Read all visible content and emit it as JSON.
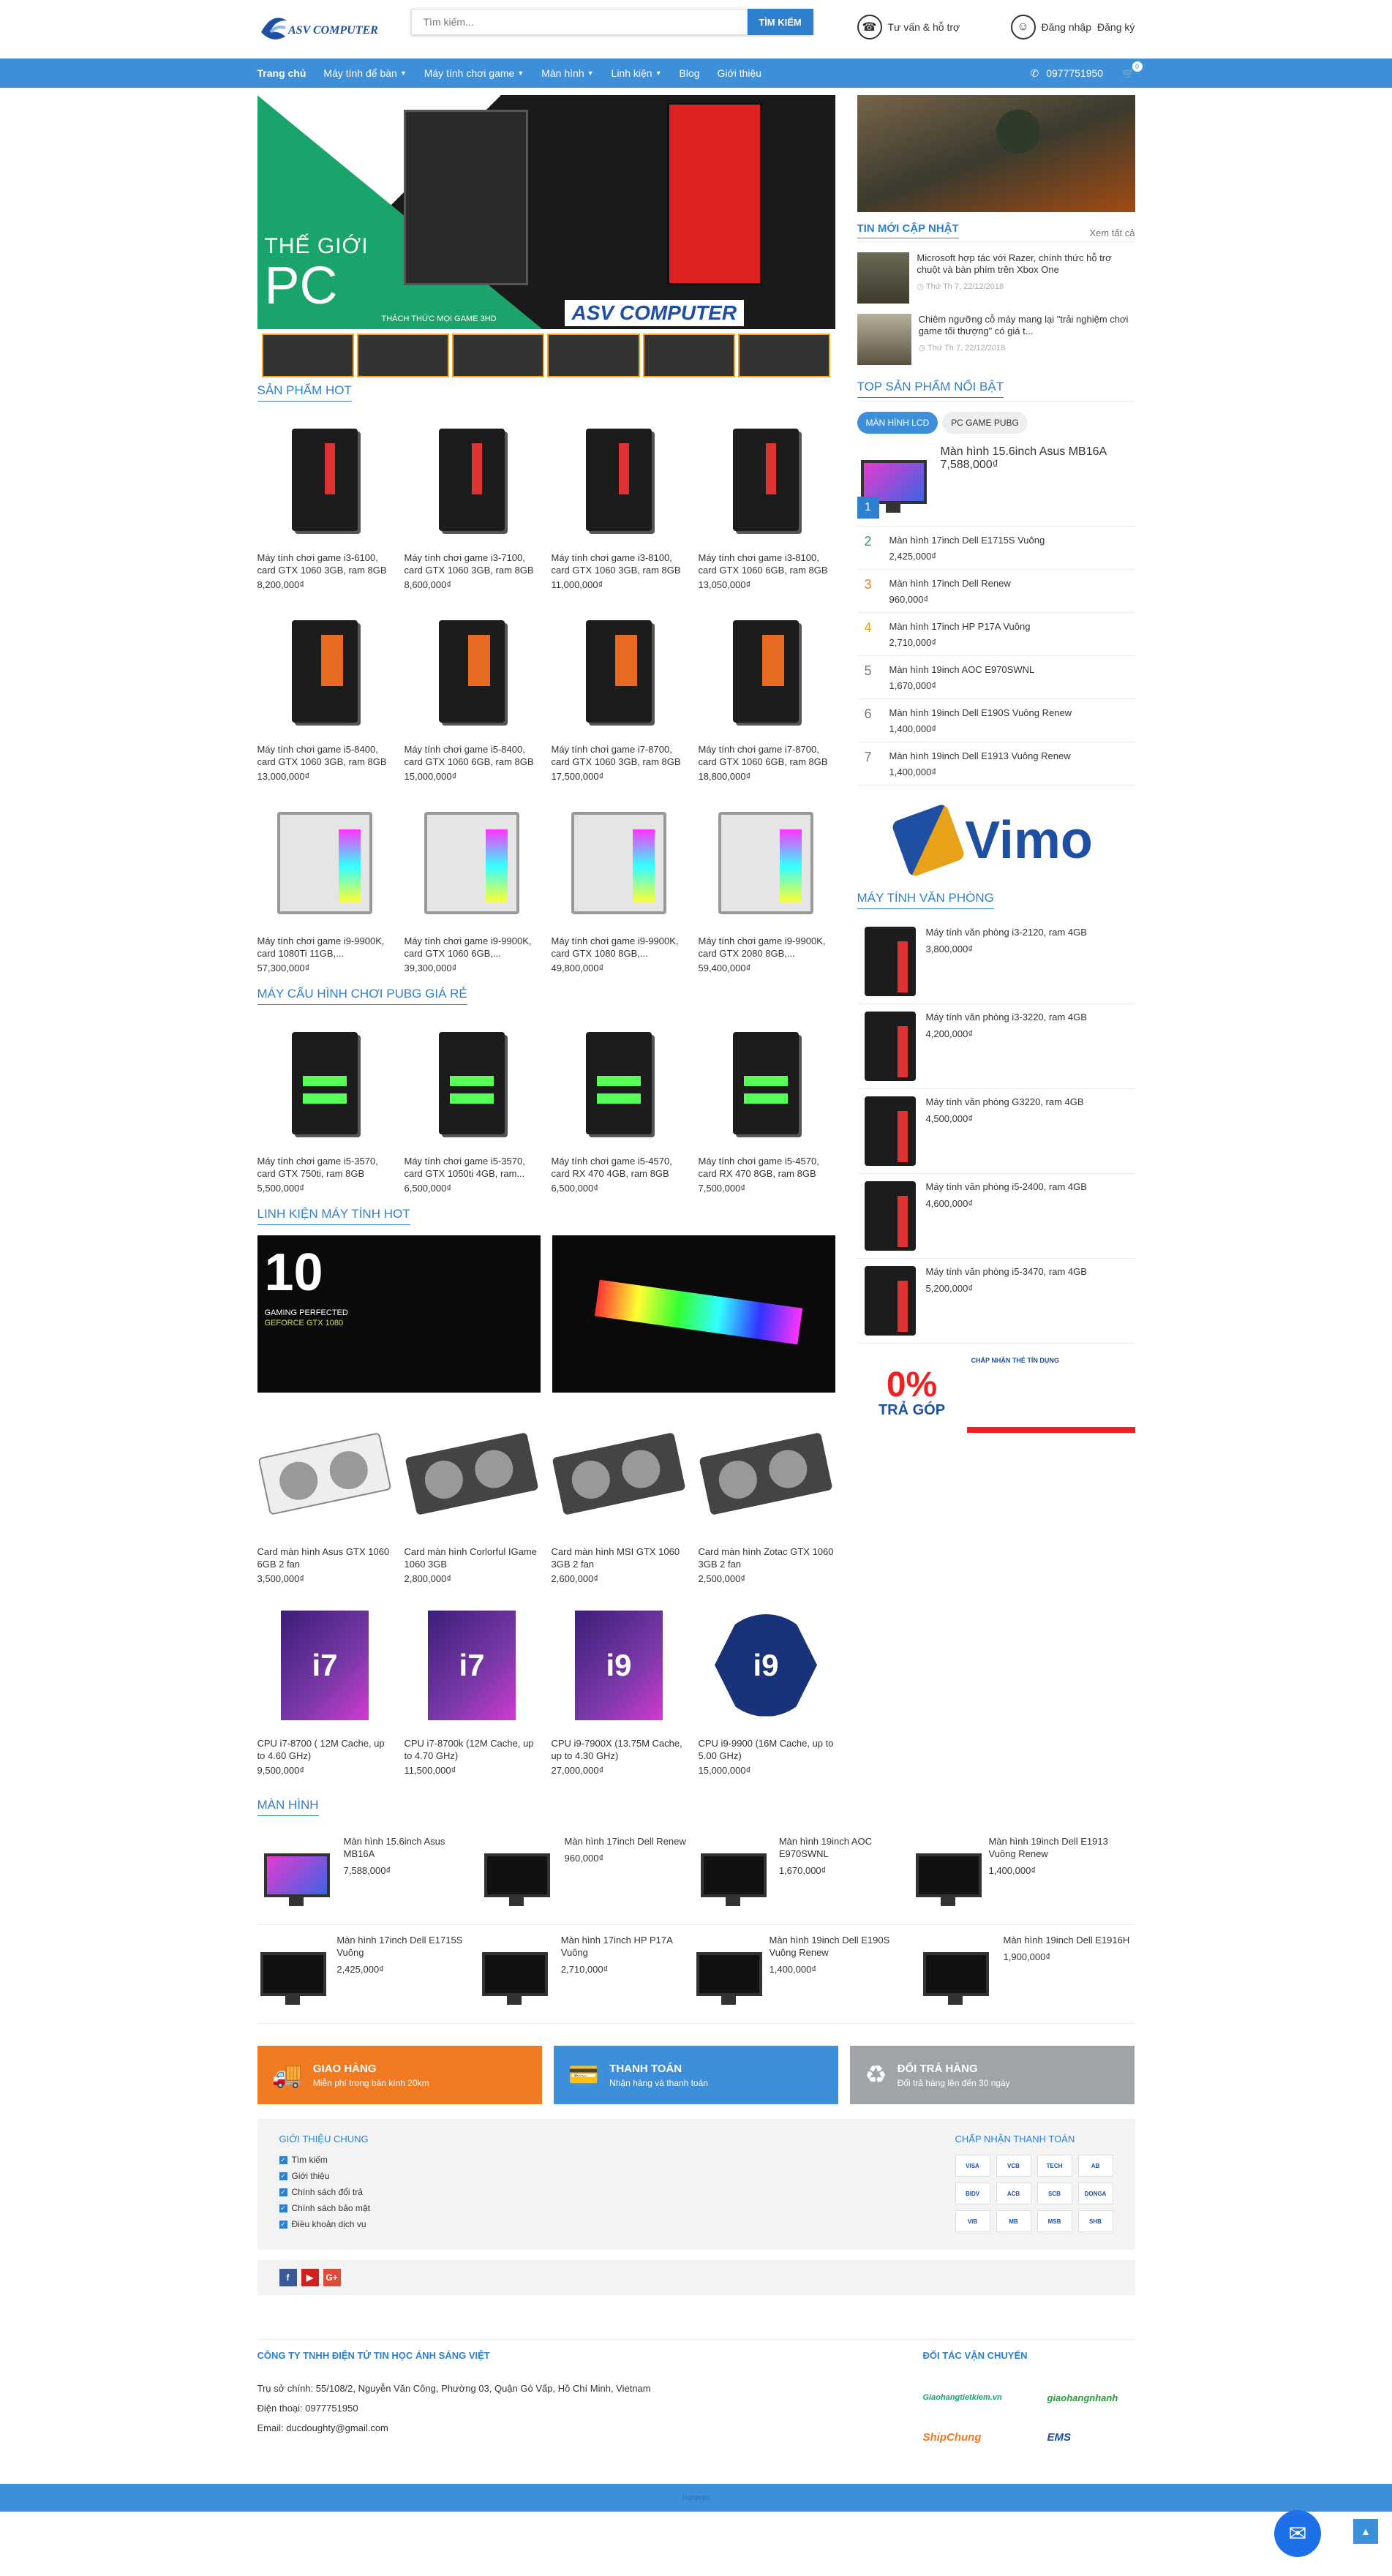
{
  "header": {
    "logo_text": "ASV COMPUTER",
    "search_placeholder": "Tìm kiếm...",
    "search_button": "TÌM KIẾM",
    "support": "Tư vấn & hỗ trợ",
    "login": "Đăng nhập",
    "register": "Đăng ký"
  },
  "nav": {
    "items": [
      "Trang chủ",
      "Máy tính để bàn",
      "Máy tính chơi game",
      "Màn hình",
      "Linh kiện",
      "Blog",
      "Giới thiệu"
    ],
    "phone": "0977751950",
    "cart_count": "0"
  },
  "hero": {
    "line1": "THẾ GIỚI",
    "line2": "PC",
    "tagline": "THÁCH THỨC MỌI GAME 3HD",
    "brand": "ASV COMPUTER"
  },
  "sections": {
    "hot": "SẢN PHẨM HOT",
    "pubg": "MÁY CẤU HÌNH CHƠI PUBG GIÁ RẺ",
    "parts": "LINH KIỆN MÁY TÍNH HOT",
    "monitors": "MÀN HÌNH"
  },
  "hot_products": [
    {
      "name": "Máy tính chơi game i3-6100, card GTX 1060 3GB, ram 8GB",
      "price": "8,200,000₫"
    },
    {
      "name": "Máy tính chơi game i3-7100, card GTX 1060 3GB, ram 8GB",
      "price": "8,600,000₫"
    },
    {
      "name": "Máy tính chơi game i3-8100, card GTX 1060 3GB, ram 8GB",
      "price": "11,000,000₫"
    },
    {
      "name": "Máy tính chơi game i3-8100, card GTX 1060 6GB, ram 8GB",
      "price": "13,050,000₫"
    },
    {
      "name": "Máy tính chơi game i5-8400, card GTX 1060 3GB, ram 8GB",
      "price": "13,000,000₫"
    },
    {
      "name": "Máy tính chơi game i5-8400, card GTX 1060 6GB, ram 8GB",
      "price": "15,000,000₫"
    },
    {
      "name": "Máy tính chơi game i7-8700, card GTX 1060 3GB, ram 8GB",
      "price": "17,500,000₫"
    },
    {
      "name": "Máy tính chơi game i7-8700, card GTX 1060 6GB, ram 8GB",
      "price": "18,800,000₫"
    },
    {
      "name": "Máy tính chơi game i9-9900K, card 1080Ti 11GB,...",
      "price": "57,300,000₫"
    },
    {
      "name": "Máy tính chơi game i9-9900K, card GTX 1060 6GB,...",
      "price": "39,300,000₫"
    },
    {
      "name": "Máy tính chơi game i9-9900K, card GTX 1080 8GB,...",
      "price": "49,800,000₫"
    },
    {
      "name": "Máy tính chơi game i9-9900K, card GTX 2080 8GB,...",
      "price": "59,400,000₫"
    }
  ],
  "pubg_products": [
    {
      "name": "Máy tính chơi game i5-3570, card GTX 750ti, ram 8GB",
      "price": "5,500,000₫"
    },
    {
      "name": "Máy tính chơi game i5-3570, card GTX 1050ti 4GB, ram...",
      "price": "6,500,000₫"
    },
    {
      "name": "Máy tính chơi game i5-4570, card RX 470 4GB, ram 8GB",
      "price": "6,500,000₫"
    },
    {
      "name": "Máy tính chơi game i5-4570, card RX 470 8GB, ram 8GB",
      "price": "7,500,000₫"
    }
  ],
  "parts_banners": {
    "gtx_num": "10",
    "gtx_line1": "GAMING PERFECTED",
    "gtx_line2": "GEFORCE GTX 1080"
  },
  "parts_products": [
    {
      "name": "Card màn hình Asus GTX 1060 6GB 2 fan",
      "price": "3,500,000₫"
    },
    {
      "name": "Card màn hình Corlorful IGame 1060 3GB",
      "price": "2,800,000₫"
    },
    {
      "name": "Card màn hình MSI GTX 1060 3GB 2 fan",
      "price": "2,600,000₫"
    },
    {
      "name": "Card màn hình Zotac GTX 1060 3GB 2 fan",
      "price": "2,500,000₫"
    },
    {
      "name": "CPU i7-8700 ( 12M Cache, up to 4.60 GHz)",
      "price": "9,500,000₫",
      "label": "i7"
    },
    {
      "name": "CPU i7-8700k (12M Cache, up to 4.70 GHz)",
      "price": "11,500,000₫",
      "label": "i7"
    },
    {
      "name": "CPU i9-7900X (13.75M Cache, up to 4.30 GHz)",
      "price": "27,000,000₫",
      "label": "i9"
    },
    {
      "name": "CPU i9-9900 (16M Cache, up to 5.00 GHz)",
      "price": "15,000,000₫",
      "label": "i9"
    }
  ],
  "monitors": [
    {
      "name": "Màn hình 15.6inch Asus MB16A",
      "price": "7,588,000₫"
    },
    {
      "name": "Màn hình 17inch Dell Renew",
      "price": "960,000₫"
    },
    {
      "name": "Màn hình 19inch AOC E970SWNL",
      "price": "1,670,000₫"
    },
    {
      "name": "Màn hình 19inch Dell E1913 Vuông Renew",
      "price": "1,400,000₫"
    },
    {
      "name": "Màn hình 17inch Dell E1715S Vuông",
      "price": "2,425,000₫"
    },
    {
      "name": "Màn hình 17inch HP P17A Vuông",
      "price": "2,710,000₫"
    },
    {
      "name": "Màn hình 19inch Dell E190S Vuông Renew",
      "price": "1,400,000₫"
    },
    {
      "name": "Màn hình 19inch Dell E1916H",
      "price": "1,900,000₫"
    }
  ],
  "services": [
    {
      "title": "GIAO HÀNG",
      "sub": "Miễn phí trong bán kính 20km"
    },
    {
      "title": "THANH TOÁN",
      "sub": "Nhận hàng và thanh toán"
    },
    {
      "title": "ĐỔI TRẢ HÀNG",
      "sub": "Đổi trả hàng lên đến 30 ngày"
    }
  ],
  "footer": {
    "intro_title": "GIỚI THIỆU CHUNG",
    "intro_links": [
      "Tìm kiếm",
      "Giới thiệu",
      "Chính sách đổi trả",
      "Chính sách bảo mật",
      "Điều khoản dịch vụ"
    ],
    "pay_title": "CHẤP NHẬN THANH TOÁN",
    "pay_logos": [
      "VISA",
      "VCB",
      "TECH",
      "AB",
      "BIDV",
      "ACB",
      "SCB",
      "DONGA",
      "VIB",
      "MB",
      "MSB",
      "SHB"
    ],
    "social": [
      "f",
      "▶",
      "G+"
    ],
    "company": "CÔNG TY TNHH ĐIỆN TỬ TIN HỌC ÁNH SÁNG VIỆT",
    "address": "Trụ sở chính: 55/108/2, Nguyễn Văn Công, Phường 03, Quận Gò Vấp, Hồ Chí Minh, Vietnam",
    "phone": "Điện thoại: 0977751950",
    "email": "Email: ducdoughty@gmail.com",
    "shipping_title": "ĐỐI TÁC VẬN CHUYỂN",
    "shipping": [
      "Giaohangtietkiem.vn",
      "giaohangnhanh",
      "ShipChung",
      "EMS"
    ],
    "bottom": "Haravan"
  },
  "sidebar": {
    "news_title": "TIN MỚI CẬP NHẬT",
    "news_more": "Xem tất cả",
    "news": [
      {
        "title": "Microsoft hợp tác với Razer, chính thức hỗ trợ chuột và bàn phím trên Xbox One",
        "date": "Thứ Th 7, 22/12/2018"
      },
      {
        "title": "Chiêm ngưỡng cỗ máy mang lại \"trải nghiệm chơi game tối thượng\" có giá t...",
        "date": "Thứ Th 7, 22/12/2018"
      }
    ],
    "top_title": "TOP SẢN PHẨM NỔI BẬT",
    "tabs": [
      "MÀN HÌNH LCD",
      "PC GAME PUBG"
    ],
    "top": [
      {
        "rank": "1",
        "name": "Màn hình 15.6inch Asus MB16A",
        "price": "7,588,000₫"
      },
      {
        "rank": "2",
        "name": "Màn hình 17inch Dell E1715S Vuông",
        "price": "2,425,000₫"
      },
      {
        "rank": "3",
        "name": "Màn hình 17inch Dell Renew",
        "price": "960,000₫"
      },
      {
        "rank": "4",
        "name": "Màn hình 17inch HP P17A Vuông",
        "price": "2,710,000₫"
      },
      {
        "rank": "5",
        "name": "Màn hình 19inch AOC E970SWNL",
        "price": "1,670,000₫"
      },
      {
        "rank": "6",
        "name": "Màn hình 19inch Dell E190S Vuông Renew",
        "price": "1,400,000₫"
      },
      {
        "rank": "7",
        "name": "Màn hình 19inch Dell E1913 Vuông Renew",
        "price": "1,400,000₫"
      }
    ],
    "vimo": "Vimo",
    "office_title": "MÁY TÍNH VĂN PHÒNG",
    "office": [
      {
        "name": "Máy tính văn phòng i3-2120, ram 4GB",
        "price": "3,800,000₫"
      },
      {
        "name": "Máy tính văn phòng i3-3220, ram 4GB",
        "price": "4,200,000₫"
      },
      {
        "name": "Máy tính văn phòng G3220, ram 4GB",
        "price": "4,500,000₫"
      },
      {
        "name": "Máy tính văn phòng i5-2400, ram 4GB",
        "price": "4,600,000₫"
      },
      {
        "name": "Máy tính văn phòng i5-3470, ram 4GB",
        "price": "5,200,000₫"
      }
    ],
    "installment_a": "0%",
    "installment_sub": "TRẢ GÓP",
    "installment_b": "CHẤP NHẬN THẺ TÍN DỤNG"
  },
  "colors": {
    "primary": "#3d8fd9",
    "orange": "#f07b22",
    "gray": "#a0a4a8"
  }
}
